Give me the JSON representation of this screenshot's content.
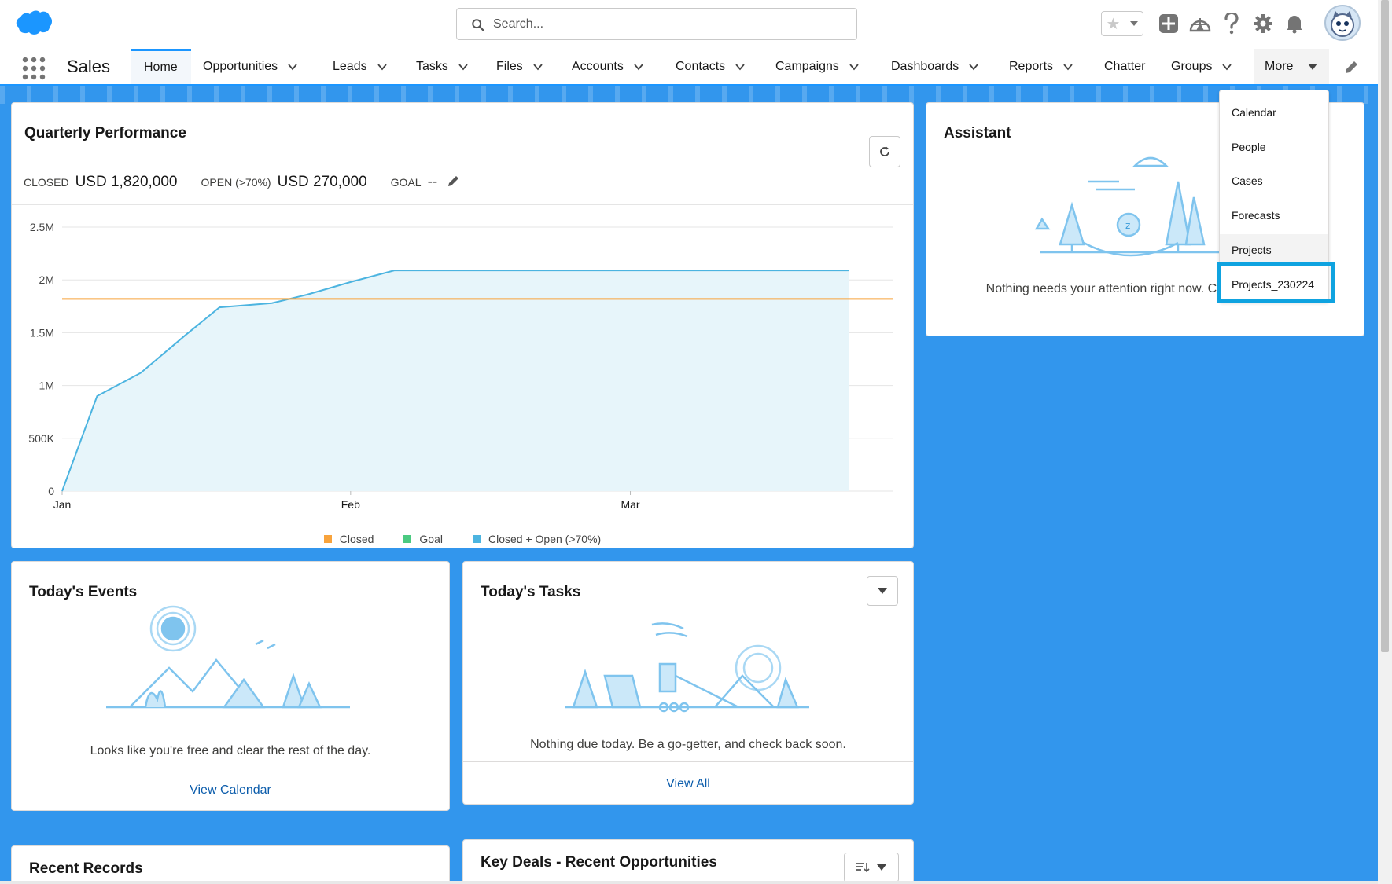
{
  "search": {
    "placeholder": "Search..."
  },
  "app": {
    "name": "Sales"
  },
  "nav": {
    "items": [
      {
        "label": "Home",
        "dropdown": false,
        "active": true
      },
      {
        "label": "Opportunities",
        "dropdown": true
      },
      {
        "label": "Leads",
        "dropdown": true
      },
      {
        "label": "Tasks",
        "dropdown": true
      },
      {
        "label": "Files",
        "dropdown": true
      },
      {
        "label": "Accounts",
        "dropdown": true
      },
      {
        "label": "Contacts",
        "dropdown": true
      },
      {
        "label": "Campaigns",
        "dropdown": true
      },
      {
        "label": "Dashboards",
        "dropdown": true
      },
      {
        "label": "Reports",
        "dropdown": true
      },
      {
        "label": "Chatter",
        "dropdown": false
      },
      {
        "label": "Groups",
        "dropdown": true
      }
    ],
    "more_label": "More"
  },
  "more_menu": {
    "items": [
      "Calendar",
      "People",
      "Cases",
      "Forecasts",
      "Projects",
      "Projects_230224"
    ],
    "highlighted": "Projects_230224"
  },
  "quarterly": {
    "title": "Quarterly Performance",
    "closed_label": "CLOSED",
    "closed_value": "USD 1,820,000",
    "open_label": "OPEN (>70%)",
    "open_value": "USD 270,000",
    "goal_label": "GOAL",
    "goal_value": "--"
  },
  "chart_data": {
    "type": "line",
    "title": "Quarterly Performance",
    "x_ticks": [
      "Jan",
      "Feb",
      "Mar"
    ],
    "y_ticks": [
      "0",
      "500K",
      "1M",
      "1.5M",
      "2M",
      "2.5M"
    ],
    "ylim": [
      0,
      2500000
    ],
    "series": [
      {
        "name": "Closed",
        "color": "#f8a33c",
        "values": []
      },
      {
        "name": "Goal",
        "color": "#4bca81",
        "values": []
      },
      {
        "name": "Closed + Open (>70%)",
        "color": "#4cb4e0",
        "x_days": [
          0,
          4,
          9,
          14,
          18,
          24,
          28,
          33,
          38,
          71,
          90
        ],
        "values": [
          0,
          900000,
          1120000,
          1470000,
          1740000,
          1780000,
          1860000,
          1980000,
          2090000,
          2090000,
          2090000
        ]
      }
    ],
    "reference_line": {
      "value": 1820000,
      "color": "#f8a33c"
    },
    "legend": [
      "Closed",
      "Goal",
      "Closed + Open (>70%)"
    ],
    "legend_position": "bottom",
    "grid": true
  },
  "assistant": {
    "title": "Assistant",
    "message": "Nothing needs your attention right now. Check back later."
  },
  "events": {
    "title": "Today's Events",
    "message": "Looks like you're free and clear the rest of the day.",
    "link": "View Calendar"
  },
  "tasks": {
    "title": "Today's Tasks",
    "message": "Nothing due today. Be a go-getter, and check back soon.",
    "link": "View All"
  },
  "recent": {
    "title": "Recent Records"
  },
  "key_deals": {
    "title": "Key Deals - Recent Opportunities"
  },
  "colors": {
    "brand": "#1b96ff",
    "background": "#3296ed",
    "link": "#0b5cab",
    "highlight": "#0fa3e0"
  }
}
